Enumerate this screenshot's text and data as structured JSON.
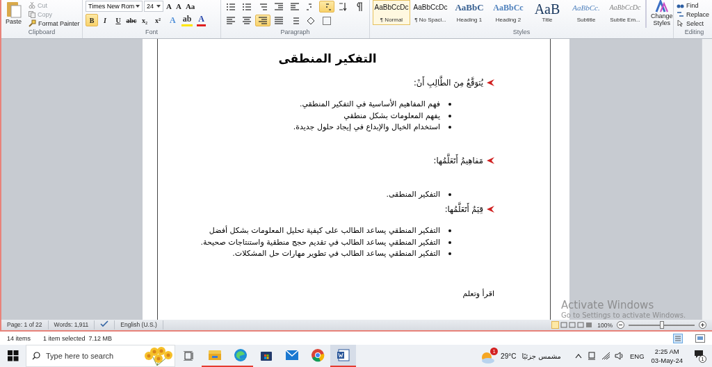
{
  "ribbon": {
    "clipboard": {
      "label": "Clipboard",
      "paste": "Paste",
      "tools": [
        {
          "kind": "cut",
          "label": "Cut",
          "disabled": true
        },
        {
          "kind": "copy",
          "label": "Copy",
          "disabled": true
        },
        {
          "kind": "painter",
          "label": "Format Painter",
          "disabled": false
        }
      ]
    },
    "font": {
      "label": "Font",
      "name": "Times New Rom",
      "size": "24",
      "size_tools": [
        "A",
        "A",
        "Aa"
      ],
      "format_buttons": [
        {
          "label": "B",
          "selected": true
        },
        {
          "label": "I",
          "selected": false
        },
        {
          "label": "U",
          "selected": false
        },
        {
          "label": "abc",
          "selected": false
        },
        {
          "label": "x₂",
          "selected": false
        },
        {
          "label": "x²",
          "selected": false
        }
      ],
      "color_buttons": [
        "A",
        "ab",
        "A"
      ]
    },
    "paragraph": {
      "label": "Paragraph",
      "row1": [
        {
          "kind": "bullets",
          "selected": false
        },
        {
          "kind": "numbering",
          "selected": false
        },
        {
          "kind": "multilevel",
          "selected": false
        },
        {
          "kind": "outdent",
          "selected": false
        },
        {
          "kind": "indent",
          "selected": false
        },
        {
          "kind": "ltr",
          "selected": false
        },
        {
          "kind": "rtl",
          "selected": true
        },
        {
          "kind": "sort",
          "selected": false
        },
        {
          "kind": "pilcrow",
          "selected": false
        }
      ],
      "row2": [
        {
          "kind": "align-left",
          "selected": false
        },
        {
          "kind": "align-center",
          "selected": false
        },
        {
          "kind": "align-right",
          "selected": true
        },
        {
          "kind": "justify",
          "selected": false
        },
        {
          "kind": "spacing",
          "selected": false
        },
        {
          "kind": "shading",
          "selected": false
        },
        {
          "kind": "borders",
          "selected": false
        }
      ]
    },
    "styles": {
      "label": "Styles",
      "items": [
        {
          "kind": "normal",
          "preview": "AaBbCcDc",
          "name": "¶ Normal",
          "selected": true
        },
        {
          "kind": "normal",
          "preview": "AaBbCcDc",
          "name": "¶ No Spaci...",
          "selected": false
        },
        {
          "kind": "heading1",
          "preview": "AaBbC",
          "name": "Heading 1",
          "selected": false
        },
        {
          "kind": "heading2",
          "preview": "AaBbCc",
          "name": "Heading 2",
          "selected": false
        },
        {
          "kind": "title",
          "preview": "AaB",
          "name": "Title",
          "selected": false
        },
        {
          "kind": "subtitle",
          "preview": "AaBbCc.",
          "name": "Subtitle",
          "selected": false
        },
        {
          "kind": "emphasis",
          "preview": "AaBbCcDc",
          "name": "Subtle Em...",
          "selected": false
        }
      ],
      "change": [
        "Change",
        "Styles"
      ]
    },
    "editing": {
      "label": "Editing",
      "tools": [
        {
          "kind": "find",
          "label": "Find"
        },
        {
          "kind": "replace",
          "label": "Replace"
        },
        {
          "kind": "select",
          "label": "Select"
        }
      ]
    }
  },
  "document": {
    "title": "التفكير المنطقى",
    "sections": [
      {
        "heading": "يُتوَقَّعُ مِنَ الطَّالِبِ أَنْ:",
        "items": [
          "فهم المفاهيم الأساسية في التفكير المنطقي.",
          "يفهم المعلومات بشكل منطقي",
          "استخدام الخيال والإبداع في إيجاد حلول جديدة."
        ]
      },
      {
        "heading": "مَفاهِيمُ أَتَعَلَّمُها:",
        "items": [
          "التفكير المنطقى."
        ]
      },
      {
        "heading": "قِيَمٌ أَتَعَلَّمُها:",
        "items": [
          "التفكير المنطقي يساعد الطالب  على كيفية تحليل المعلومات بشكل أفضل",
          "التفكير المنطقي يساعد الطالب في تقديم حجج منطقية واستنتاجات صحيحة.",
          "التفكير المنطقي يساعد الطالب في تطوير مهارات حل المشكلات."
        ]
      }
    ],
    "closing": "اقرأ وتعلم"
  },
  "activation": {
    "title": "Activate Windows",
    "subtitle": "Go to Settings to activate Windows."
  },
  "status_bar": {
    "page": "Page: 1 of 22",
    "words": "Words: 1,911",
    "language": "English (U.S.)",
    "zoom": "100%",
    "zoom_level": {
      "level": 0.5
    }
  },
  "explorer_status": {
    "count": "14 items",
    "selection": "1 item selected  7.12 MB"
  },
  "taskbar": {
    "search": {
      "placeholder": "Type here to search"
    },
    "apps": [
      {
        "kind": "explorer",
        "running": true,
        "selected": false
      },
      {
        "kind": "edge",
        "running": true,
        "selected": false
      },
      {
        "kind": "store",
        "running": false,
        "selected": false
      },
      {
        "kind": "mail",
        "running": false,
        "selected": false
      },
      {
        "kind": "chrome",
        "running": false,
        "selected": false
      },
      {
        "kind": "word",
        "running": true,
        "selected": true
      }
    ],
    "weather": {
      "badge": "1",
      "temperature": "29°C",
      "condition": "مشمس جزئيًا"
    },
    "language": "ENG",
    "time": "2:25 AM",
    "date": "03-May-24",
    "notifications": "1"
  }
}
